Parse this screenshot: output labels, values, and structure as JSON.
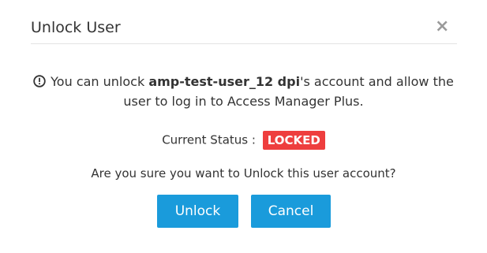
{
  "dialog": {
    "title": "Unlock User",
    "close_symbol": "×",
    "close_icon": "close-icon",
    "info_icon": "info-circle-icon"
  },
  "message": {
    "prefix": "You can unlock ",
    "username": "amp-test-user_12 dpi",
    "suffix": "'s account and allow the",
    "line2": "user to log in to Access Manager Plus."
  },
  "status": {
    "label": "Current Status :",
    "value": "LOCKED",
    "badge_color": "#ee3e3e"
  },
  "confirm_text": "Are you sure you want to Unlock this user account?",
  "buttons": {
    "unlock_label": "Unlock",
    "cancel_label": "Cancel",
    "color": "#1a9bdb"
  }
}
